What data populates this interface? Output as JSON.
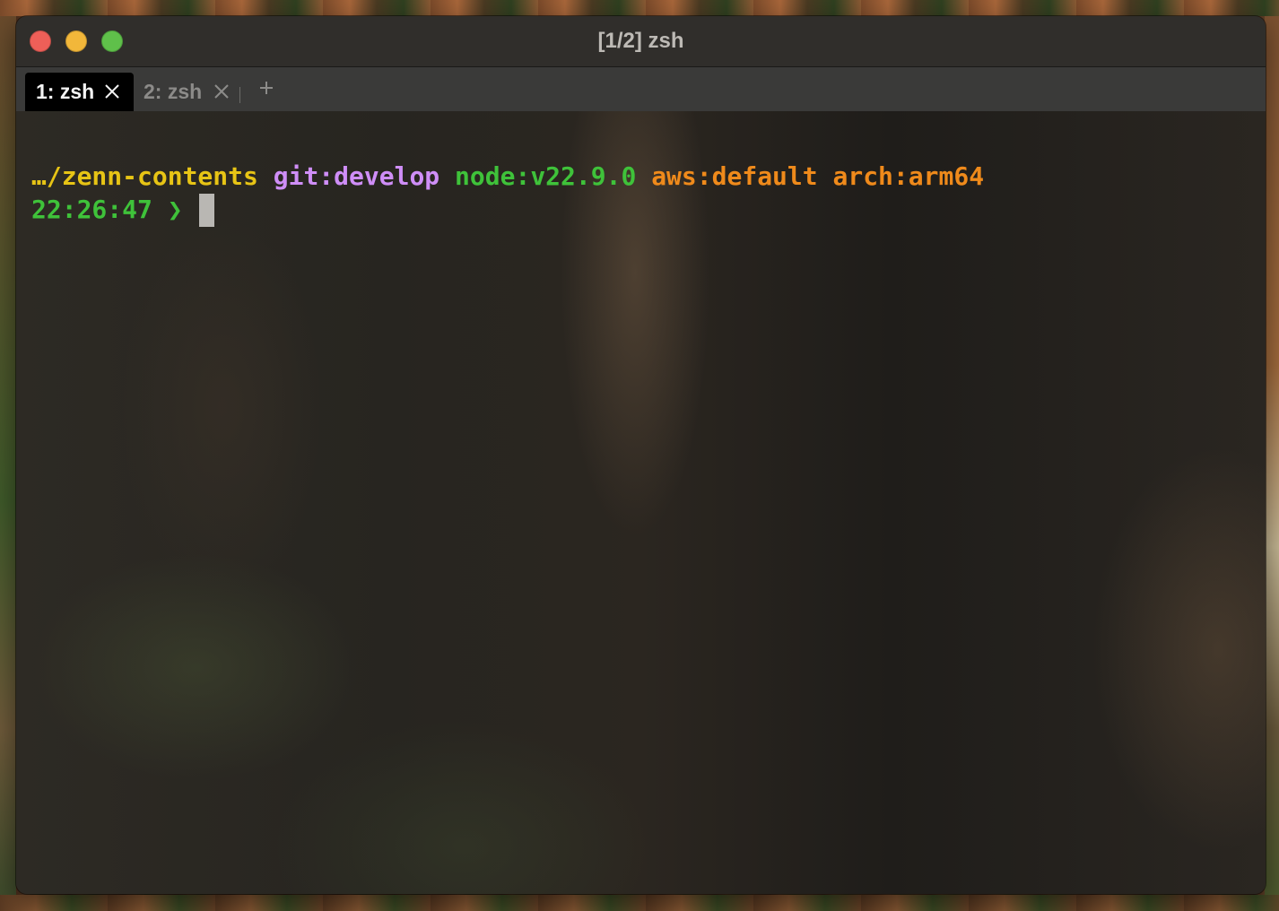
{
  "window": {
    "title": "[1/2] zsh"
  },
  "tabs": [
    {
      "label": "1: zsh",
      "active": true
    },
    {
      "label": "2: zsh",
      "active": false
    }
  ],
  "new_tab_icon": "plus-icon",
  "close_icon": "close-icon",
  "prompt": {
    "path": "…/zenn-contents",
    "git": "git:develop",
    "node": "node:v22.9.0",
    "aws": "aws:default",
    "arch": "arch:arm64",
    "time": "22:26:47",
    "symbol": "❯"
  },
  "colors": {
    "path": "#e7c415",
    "git": "#cf8ef7",
    "node": "#3fc23a",
    "aws": "#ef8a1b",
    "arch": "#ef8a1b",
    "time": "#3fc23a",
    "close_button": "#ee5f58",
    "minimize_button": "#f2b73a",
    "zoom_button": "#5fc04a"
  }
}
